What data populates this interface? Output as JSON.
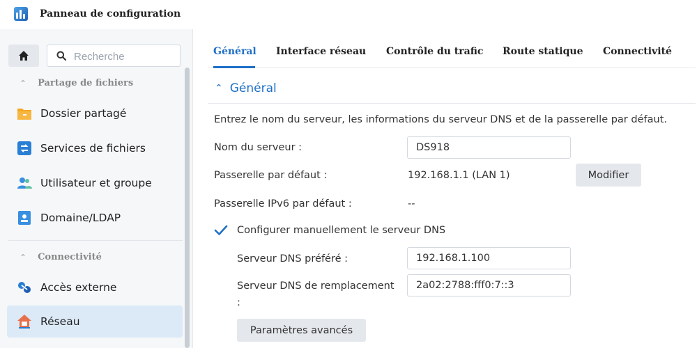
{
  "window": {
    "title": "Panneau de configuration",
    "icon": "control-panel-icon"
  },
  "sidebar": {
    "search_placeholder": "Recherche",
    "sections": [
      {
        "title": "Partage de fichiers",
        "items": [
          {
            "label": "Dossier partagé",
            "icon": "folder-icon",
            "color": "#f0a830"
          },
          {
            "label": "Services de fichiers",
            "icon": "file-services-icon",
            "color": "#2a7fd4"
          },
          {
            "label": "Utilisateur et groupe",
            "icon": "users-icon",
            "color": "#3a8fe0"
          },
          {
            "label": "Domaine/LDAP",
            "icon": "domain-icon",
            "color": "#3a8fe0"
          }
        ]
      },
      {
        "title": "Connectivité",
        "items": [
          {
            "label": "Accès externe",
            "icon": "external-access-icon",
            "color": "#2a7fd4"
          },
          {
            "label": "Réseau",
            "icon": "network-home-icon",
            "color": "#e8704a",
            "active": true
          }
        ]
      }
    ]
  },
  "tabs": [
    {
      "label": "Général",
      "active": true
    },
    {
      "label": "Interface réseau"
    },
    {
      "label": "Contrôle du trafic"
    },
    {
      "label": "Route statique"
    },
    {
      "label": "Connectivité"
    }
  ],
  "general": {
    "section_title": "Général",
    "description": "Entrez le nom du serveur, les informations du serveur DNS et de la passerelle par défaut.",
    "server_name_label": "Nom du serveur :",
    "server_name_value": "DS918",
    "gateway_label": "Passerelle par défaut :",
    "gateway_value": "192.168.1.1 (LAN 1)",
    "modify_button": "Modifier",
    "ipv6_gateway_label": "Passerelle IPv6 par défaut :",
    "ipv6_gateway_value": "--",
    "manual_dns_label": "Configurer manuellement le serveur DNS",
    "manual_dns_checked": true,
    "preferred_dns_label": "Serveur DNS préféré :",
    "preferred_dns_value": "192.168.1.100",
    "alternate_dns_label": "Serveur DNS de remplacement",
    "alternate_dns_suffix": ":",
    "alternate_dns_value": "2a02:2788:fff0:7::3",
    "advanced_button": "Paramètres avancés"
  },
  "colors": {
    "accent": "#1e6fc6",
    "active_bg": "#dceaf8"
  }
}
